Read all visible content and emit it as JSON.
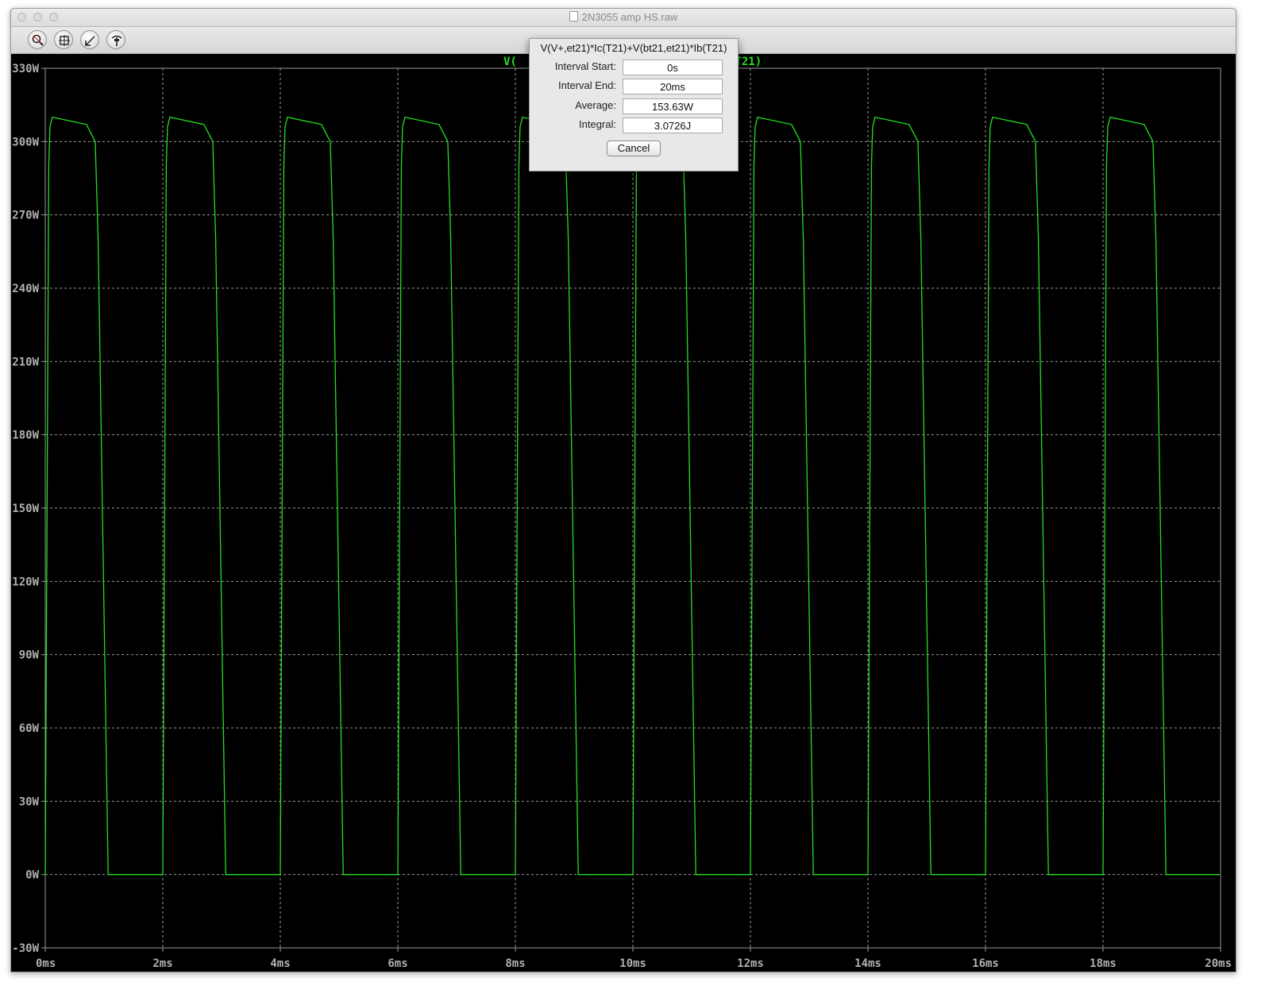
{
  "window": {
    "title": "2N3055 amp HS.raw"
  },
  "toolbar": {
    "buttons": [
      "zoom-icon",
      "autorange-icon",
      "zoom-back-icon",
      "probe-icon"
    ]
  },
  "plot": {
    "trace_label_left": "V(",
    "trace_label_right": "(T21)",
    "trace_color": "#22e022"
  },
  "dialog": {
    "title": "V(V+,et21)*Ic(T21)+V(bt21,et21)*Ib(T21)",
    "fields": [
      {
        "label": "Interval Start:",
        "value": "0s"
      },
      {
        "label": "Interval End:",
        "value": "20ms"
      },
      {
        "label": "Average:",
        "value": "153.63W"
      },
      {
        "label": "Integral:",
        "value": "3.0726J"
      }
    ],
    "cancel_label": "Cancel"
  },
  "chart_data": {
    "type": "line",
    "xlabel": "",
    "ylabel": "",
    "xlim": [
      0,
      20
    ],
    "ylim": [
      -30,
      330
    ],
    "x_unit": "ms",
    "y_unit": "W",
    "x_ticks": [
      "0ms",
      "2ms",
      "4ms",
      "6ms",
      "8ms",
      "10ms",
      "12ms",
      "14ms",
      "16ms",
      "18ms",
      "20ms"
    ],
    "y_ticks": [
      "330W",
      "300W",
      "270W",
      "240W",
      "210W",
      "180W",
      "150W",
      "120W",
      "90W",
      "60W",
      "30W",
      "0W",
      "-30W"
    ],
    "grid": true,
    "series": [
      {
        "period_ms": 2,
        "high_W": 310,
        "low_W": 0,
        "on_time_ms": 0.95,
        "rise_start_ms": 0,
        "visible_cycles": 10
      }
    ]
  }
}
